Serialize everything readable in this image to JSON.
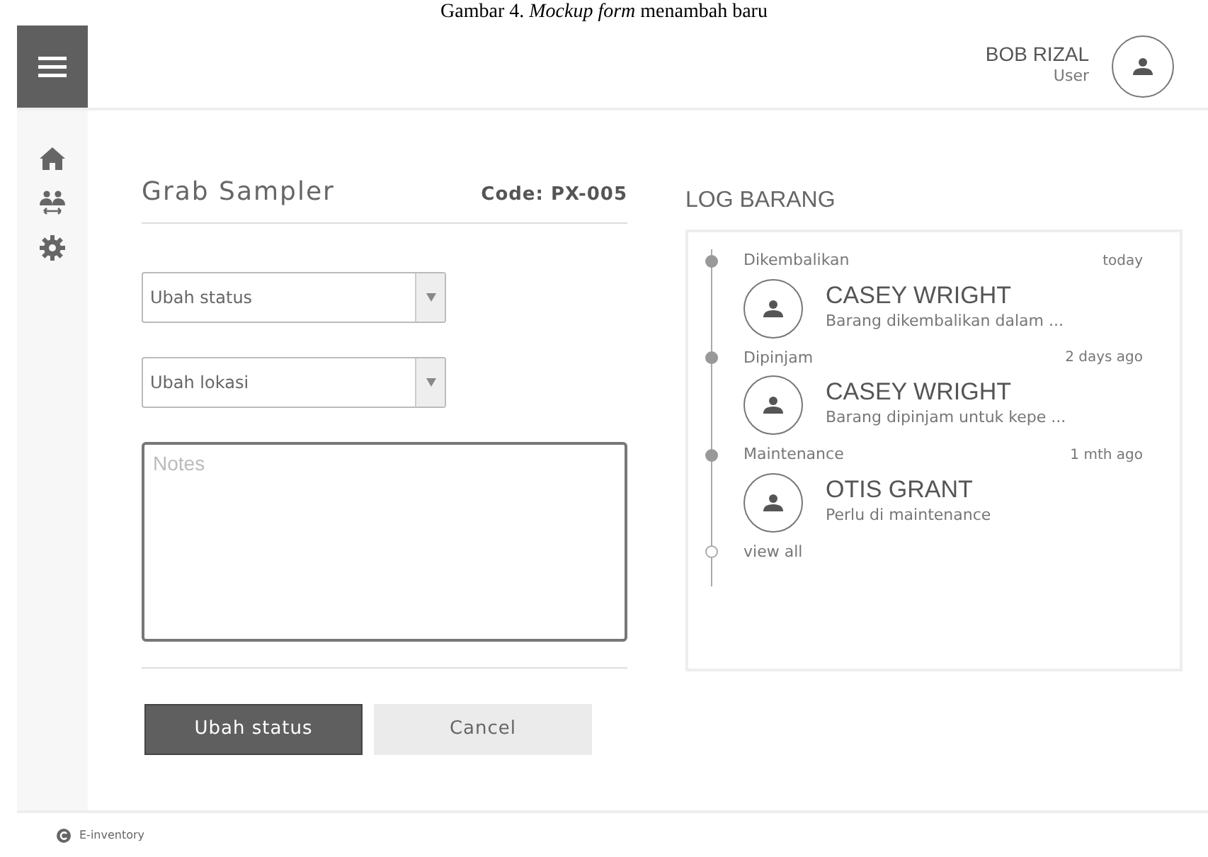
{
  "caption": "Gambar 4. *Mockup form* menambah baru",
  "header": {
    "user_name": "BOB RIZAL",
    "user_role": "User"
  },
  "form": {
    "title": "Grab Sampler",
    "code": "Code: PX-005",
    "selects": [
      {
        "placeholder": "Ubah status"
      },
      {
        "placeholder": "Ubah lokasi"
      }
    ],
    "notes": {
      "placeholder": "Notes"
    },
    "buttons": [
      {
        "label": "Ubah status",
        "kind": "primary"
      },
      {
        "label": "Cancel",
        "kind": "secondary"
      }
    ]
  },
  "log": {
    "title": "LOG BARANG",
    "entries": [
      {
        "status": "Dikembalikan",
        "time": "today",
        "name": "CASEY WRIGHT",
        "message": "Barang dikembalikan dalam ..."
      },
      {
        "status": "Dipinjam",
        "time": "2 days ago",
        "name": "CASEY WRIGHT",
        "message": "Barang dipinjam untuk kepe ..."
      },
      {
        "status": "Maintenance",
        "time": "1 mth ago",
        "name": "OTIS GRANT",
        "message": "Perlu di maintenance"
      }
    ],
    "view_all": "view all"
  },
  "footer": {
    "brand": "E-inventory"
  }
}
